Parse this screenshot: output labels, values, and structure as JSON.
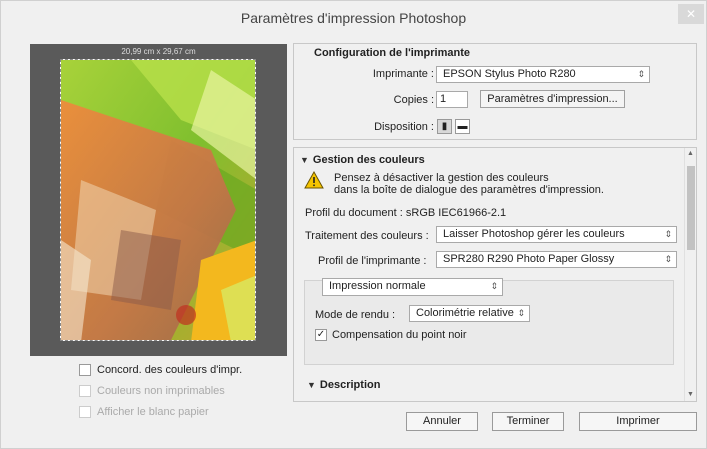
{
  "window": {
    "title": "Paramètres d'impression Photoshop",
    "close_glyph": "✕"
  },
  "preview": {
    "dimensions": "20,99 cm x 29,67 cm"
  },
  "left_options": [
    {
      "label": "Concord. des couleurs d'impr.",
      "checked": false,
      "enabled": true
    },
    {
      "label": "Couleurs non imprimables",
      "checked": false,
      "enabled": false
    },
    {
      "label": "Afficher le blanc papier",
      "checked": false,
      "enabled": false
    }
  ],
  "printer_config": {
    "title": "Configuration de l'imprimante",
    "printer_label": "Imprimante :",
    "printer_value": "EPSON Stylus Photo R280",
    "copies_label": "Copies :",
    "copies_value": "1",
    "print_settings_button": "Paramètres d'impression...",
    "layout_label": "Disposition :",
    "layout_icons": [
      "portrait-orientation-icon",
      "landscape-orientation-icon"
    ]
  },
  "color_management": {
    "title": "Gestion des couleurs",
    "warning_line1": "Pensez à désactiver la gestion des couleurs",
    "warning_line2": "dans la boîte de dialogue des paramètres d'impression.",
    "doc_profile": "Profil du document : sRGB IEC61966-2.1",
    "color_handling_label": "Traitement des couleurs :",
    "color_handling_value": "Laisser Photoshop gérer les couleurs",
    "printer_profile_label": "Profil de l'imprimante :",
    "printer_profile_value": "SPR280 R290 Photo Paper Glossy",
    "proof_setup_value": "Impression normale",
    "rendering_label": "Mode de rendu :",
    "rendering_value": "Colorimétrie relative",
    "black_point_label": "Compensation du point noir",
    "black_point_checked": true,
    "description_label": "Description"
  },
  "buttons": {
    "cancel": "Annuler",
    "done": "Terminer",
    "print": "Imprimer"
  },
  "glyphs": {
    "select_arrow": "⇕",
    "triangle": "▼",
    "check": "✓",
    "scroll_up": "▲",
    "scroll_down": "▼"
  }
}
